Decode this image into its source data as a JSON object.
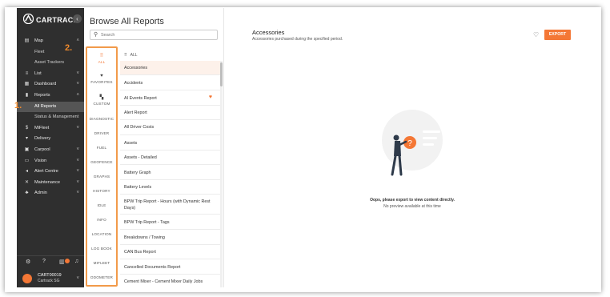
{
  "sidebar": {
    "brand": "CARTRACK",
    "items": [
      {
        "label": "Map",
        "icon": "map-icon",
        "chevron": "^",
        "sub": false
      },
      {
        "label": "Fleet",
        "sub": true
      },
      {
        "label": "Asset Trackers",
        "sub": true
      },
      {
        "label": "List",
        "icon": "list-icon",
        "chevron": "v",
        "sub": false
      },
      {
        "label": "Dashboard",
        "icon": "dashboard-icon",
        "chevron": "v",
        "sub": false
      },
      {
        "label": "Reports",
        "icon": "reports-icon",
        "chevron": "^",
        "sub": false
      },
      {
        "label": "All Reports",
        "sub": true,
        "active": true
      },
      {
        "label": "Status & Management",
        "sub": true
      },
      {
        "label": "MiFleet",
        "icon": "dollar-icon",
        "chevron": "v",
        "sub": false
      },
      {
        "label": "Delivery",
        "icon": "delivery-icon",
        "chevron": "",
        "sub": false
      },
      {
        "label": "Carpool",
        "icon": "carpool-icon",
        "chevron": "v",
        "sub": false
      },
      {
        "label": "Vision",
        "icon": "vision-icon",
        "chevron": "v",
        "sub": false
      },
      {
        "label": "Alert Centre",
        "icon": "alert-icon",
        "chevron": "v",
        "sub": false
      },
      {
        "label": "Maintenance",
        "icon": "maintenance-icon",
        "chevron": "v",
        "sub": false
      },
      {
        "label": "Admin",
        "icon": "admin-icon",
        "chevron": "v",
        "sub": false
      }
    ],
    "account": {
      "id": "CART00019",
      "company": "Cartrack SG"
    }
  },
  "callouts": {
    "one": "1.",
    "two": "2."
  },
  "browse": {
    "title": "Browse All Reports",
    "search_placeholder": "Search",
    "categories": [
      "ALL",
      "FAVORITES",
      "CUSTOM",
      "DIAGNOSTIC",
      "DRIVER",
      "FUEL",
      "GEOFENCE",
      "GRAPHS",
      "HISTORY",
      "IDLE",
      "INFO",
      "LOCATION",
      "LOG BOOK",
      "MIFLEET",
      "ODOMETER"
    ],
    "list_header": "ALL",
    "reports": [
      "Accessories",
      "Accidents",
      "AI Events Report",
      "Alert Report",
      "All Driver Costs",
      "Assets",
      "Assets - Detailed",
      "Battery Graph",
      "Battery Levels",
      "BPW Trip Report - Hours (with Dynamic Rest Days)",
      "BPW Trip Report - Tags",
      "Breakdowns / Towing",
      "CAN Bus Report",
      "Cancelled Documents Report",
      "Cement Mixer - Cement Mixer Daily Jobs"
    ]
  },
  "main": {
    "title": "Accessories",
    "subtitle": "Accessories purchased during the specified period.",
    "export_label": "EXPORT",
    "empty_title": "Oops, please export to view content directly.",
    "empty_sub": "No preview available at this time"
  },
  "colors": {
    "accent": "#f47735",
    "sidebar": "#2f2f2f",
    "callout": "#f08a2c"
  }
}
